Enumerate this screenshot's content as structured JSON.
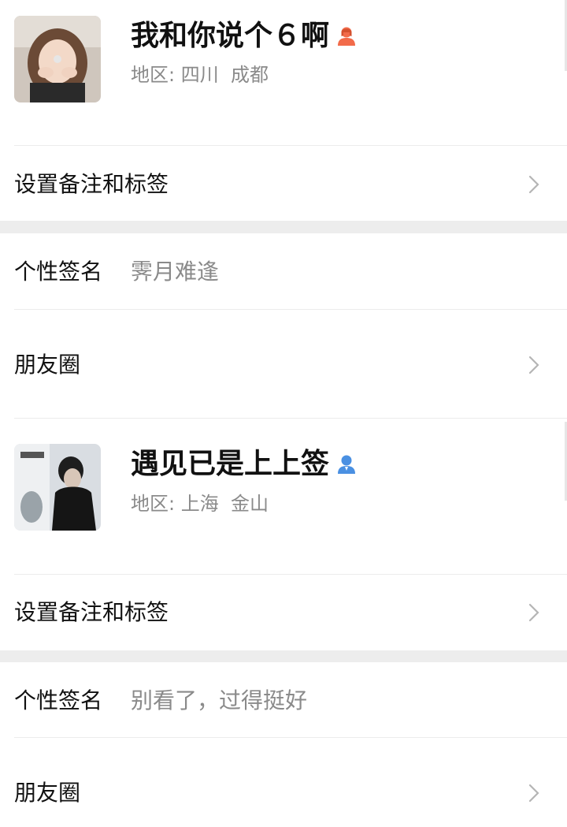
{
  "profiles": [
    {
      "name": "我和你说个６啊",
      "gender_icon": "female-user-icon",
      "gender_color": "#f26b4a",
      "region_label": "地区:",
      "region_value": "四川  成都",
      "remark_row_label": "设置备注和标签",
      "signature_label": "个性签名",
      "signature_value": "霁月难逢",
      "moments_label": "朋友圈"
    },
    {
      "name": "遇见已是上上签",
      "gender_icon": "male-user-icon",
      "gender_color": "#4a90e2",
      "region_label": "地区:",
      "region_value": "上海  金山",
      "remark_row_label": "设置备注和标签",
      "signature_label": "个性签名",
      "signature_value": "别看了，过得挺好",
      "moments_label": "朋友圈"
    }
  ],
  "colors": {
    "section_gap": "#ededed",
    "secondary_text": "#8a8a8a",
    "primary_text": "#111111"
  }
}
